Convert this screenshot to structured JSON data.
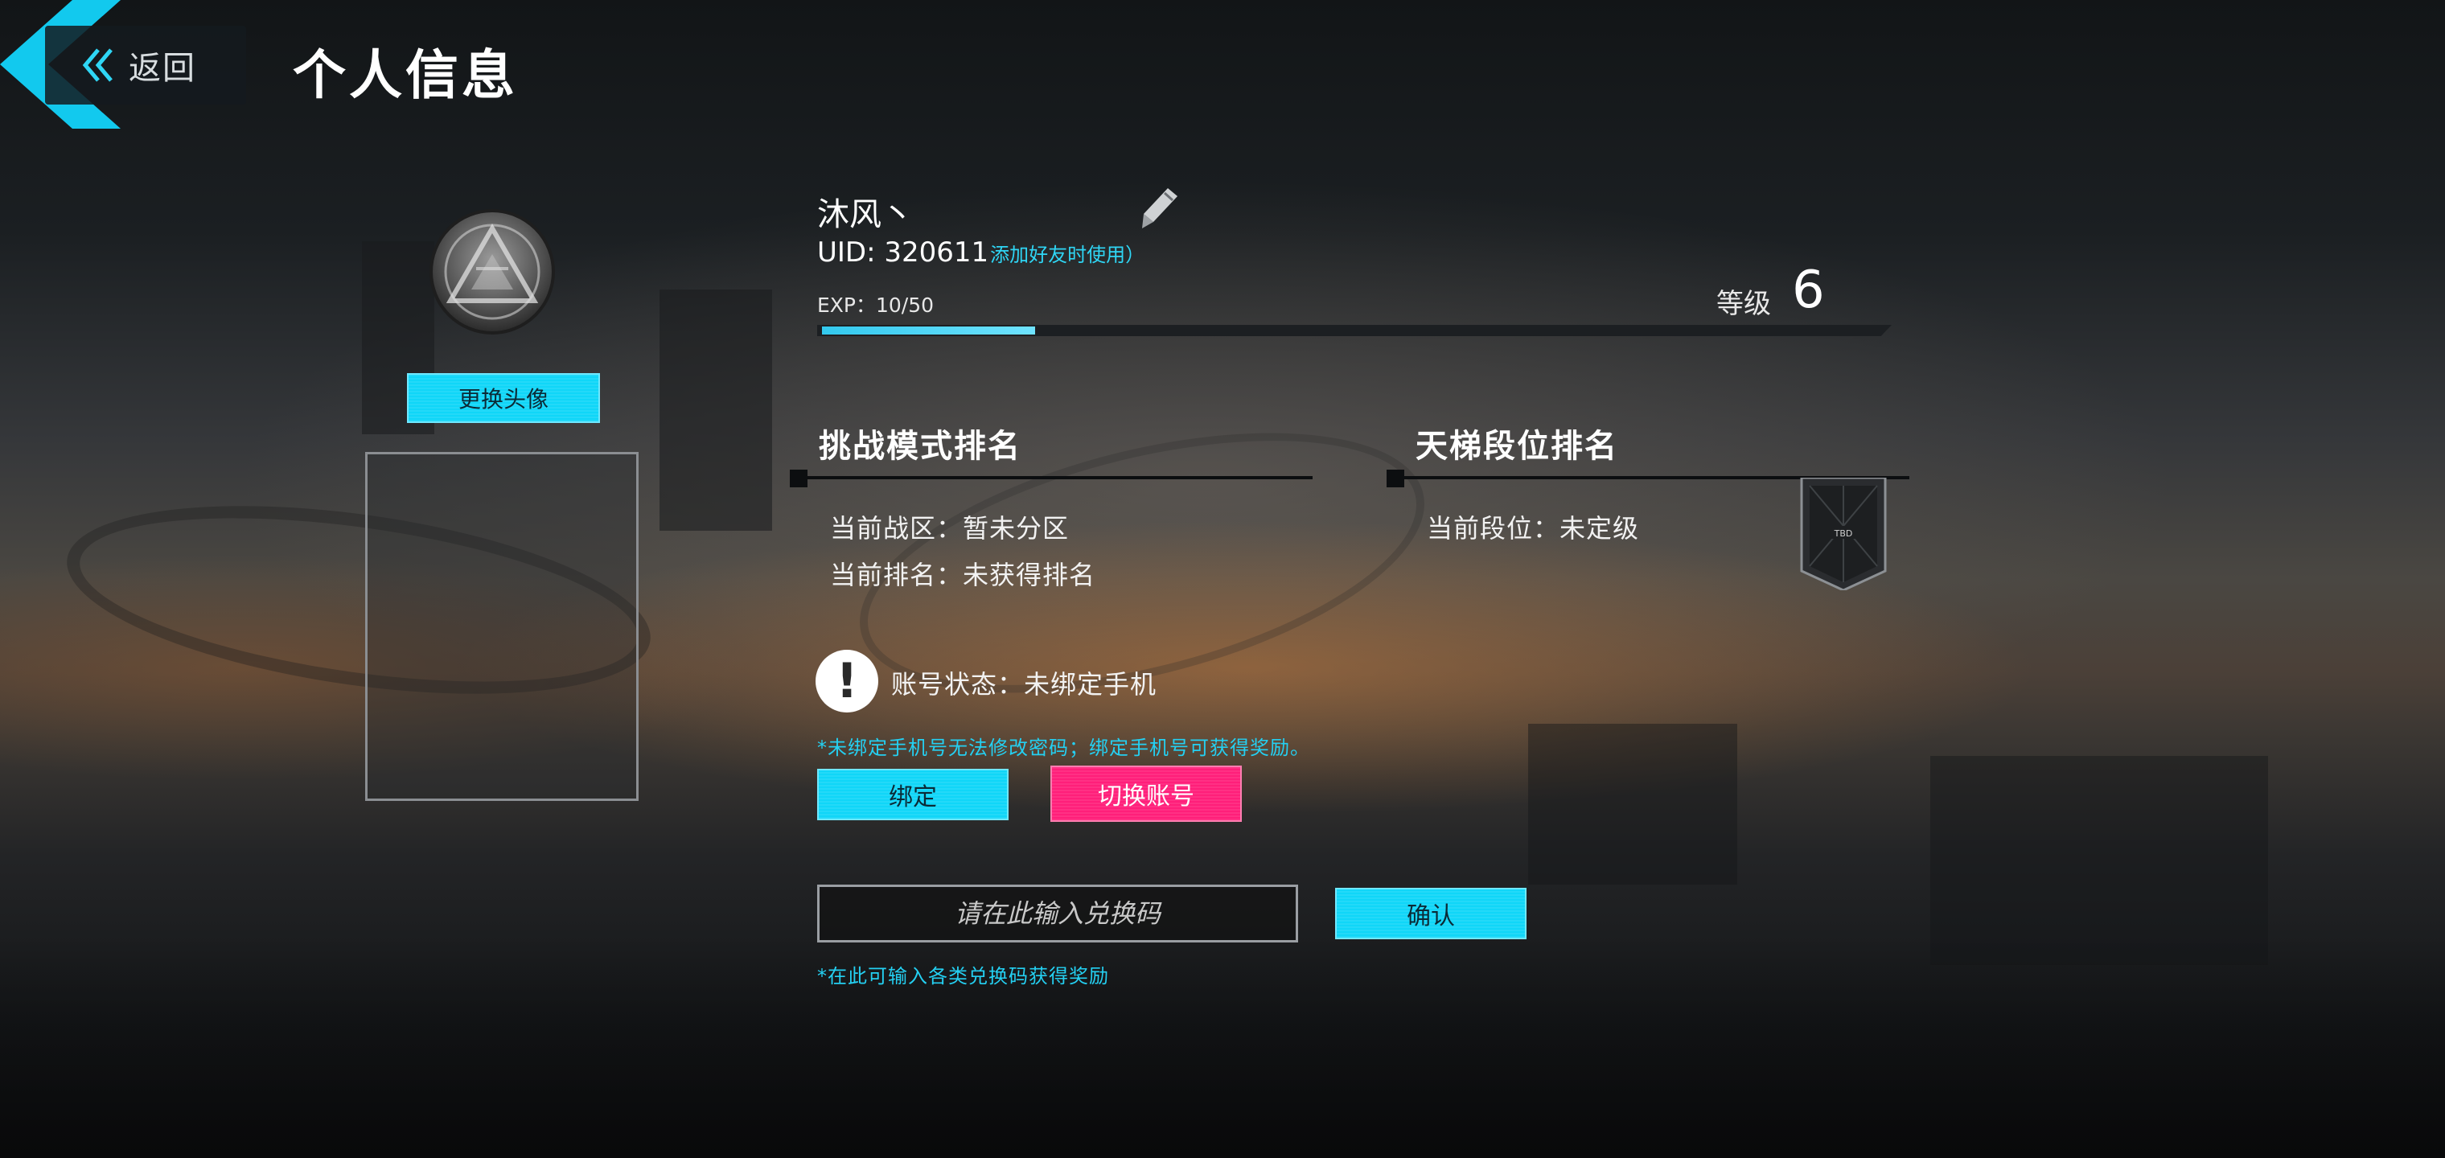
{
  "header": {
    "back_label": "返回",
    "title": "个人信息"
  },
  "left": {
    "change_avatar_label": "更换头像"
  },
  "profile": {
    "nickname": "沐风丶",
    "uid": "UID: 320611",
    "uid_hint": "添加好友时使用）",
    "exp_label": "EXP：10/50",
    "exp_fraction": 0.2,
    "level_label": "等级",
    "level_value": "6"
  },
  "challenge_rank": {
    "title": "挑战模式排名",
    "zone": "当前战区：暂未分区",
    "rank": "当前排名：未获得排名"
  },
  "ladder_rank": {
    "title": "天梯段位排名",
    "tier": "当前段位：未定级",
    "badge_text": "TBD"
  },
  "account": {
    "status": "账号状态：未绑定手机",
    "note": "*未绑定手机号无法修改密码；绑定手机号可获得奖励。",
    "bind_label": "绑定",
    "switch_label": "切换账号"
  },
  "redeem": {
    "placeholder": "请在此输入兑换码",
    "confirm_label": "确认",
    "note": "*在此可输入各类兑换码获得奖励"
  },
  "colors": {
    "accent_cyan": "#10d6f8",
    "accent_pink": "#ff1f7a",
    "note_cyan": "#24d0f2"
  }
}
